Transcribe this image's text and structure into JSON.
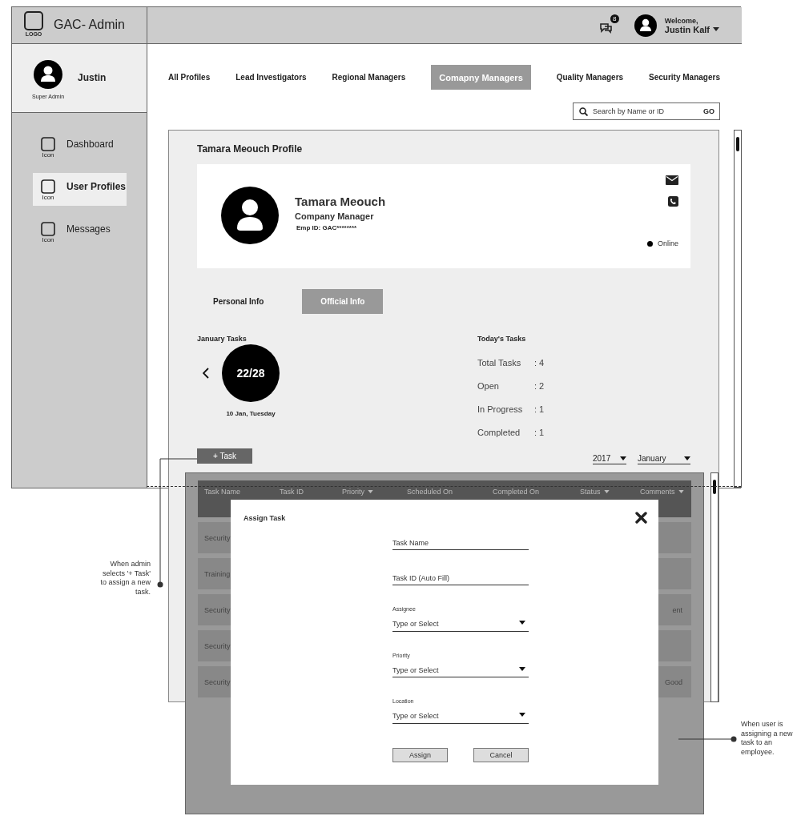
{
  "app": {
    "logo_label": "LOGO",
    "title": "GAC- Admin"
  },
  "header": {
    "notification_count": "8",
    "welcome": "Welcome,",
    "user_name": "Justin Kalf"
  },
  "sidebar": {
    "user": {
      "name": "Justin",
      "role": "Super Admin"
    },
    "items": [
      {
        "label": "Dashboard",
        "icon_label": "Icon",
        "selected": false
      },
      {
        "label": "User Profiles",
        "icon_label": "Icon",
        "selected": true
      },
      {
        "label": "Messages",
        "icon_label": "Icon",
        "selected": false
      }
    ]
  },
  "tabs": [
    {
      "label": "All Profiles",
      "selected": false
    },
    {
      "label": "Lead Investigators",
      "selected": false
    },
    {
      "label": "Regional Managers",
      "selected": false
    },
    {
      "label": "Comapny Managers",
      "selected": true
    },
    {
      "label": "Quality Managers",
      "selected": false
    },
    {
      "label": "Security Managers",
      "selected": false
    }
  ],
  "search": {
    "placeholder": "Search by Name or ID",
    "button": "GO"
  },
  "profile": {
    "title": "Tamara Meouch Profile",
    "name": "Tamara Meouch",
    "role": "Company Manager",
    "emp_id": "Emp ID: GAC********",
    "status": "Online"
  },
  "info_tabs": [
    {
      "label": "Personal Info",
      "selected": false
    },
    {
      "label": "Official Info",
      "selected": true
    }
  ],
  "monthly_tasks": {
    "title": "January Tasks",
    "count": "22/28",
    "date": "10 Jan, Tuesday"
  },
  "today_tasks": {
    "title": "Today's Tasks",
    "rows": [
      {
        "label": "Total Tasks",
        "value": ": 4"
      },
      {
        "label": "Open",
        "value": ": 2"
      },
      {
        "label": "In Progress",
        "value": ": 1"
      },
      {
        "label": "Completed",
        "value": ": 1"
      }
    ]
  },
  "add_task_button": "+ Task",
  "filters": [
    {
      "value": "2017"
    },
    {
      "value": "January"
    }
  ],
  "task_table": {
    "columns": [
      {
        "label": "Task Name",
        "sortable": false
      },
      {
        "label": "Task ID",
        "sortable": false
      },
      {
        "label": "Priority",
        "sortable": true
      },
      {
        "label": "Scheduled On",
        "sortable": false
      },
      {
        "label": "Completed On",
        "sortable": false
      },
      {
        "label": "Status",
        "sortable": true
      },
      {
        "label": "Comments",
        "sortable": true
      }
    ],
    "rows": [
      {
        "task_name": "Security"
      },
      {
        "task_name": "Training"
      },
      {
        "task_name": "Security",
        "comments": "ent"
      },
      {
        "task_name": "Security"
      },
      {
        "task_name": "Security",
        "comments": "Good"
      }
    ]
  },
  "dialog": {
    "title": "Assign Task",
    "fields": [
      {
        "kind": "text",
        "placeholder": "Task Name"
      },
      {
        "kind": "text",
        "placeholder": "Task ID (Auto Fill)"
      },
      {
        "kind": "select",
        "label": "Assignee",
        "placeholder": "Type or Select"
      },
      {
        "kind": "select",
        "label": "Priority",
        "placeholder": "Type or Select"
      },
      {
        "kind": "select",
        "label": "Location",
        "placeholder": "Type or Select"
      }
    ],
    "buttons": [
      "Assign",
      "Cancel"
    ]
  },
  "annotations": [
    {
      "text": "When admin selects '+ Task' to assign a new task."
    },
    {
      "text": "When user is assigning a new task to an employee."
    }
  ]
}
